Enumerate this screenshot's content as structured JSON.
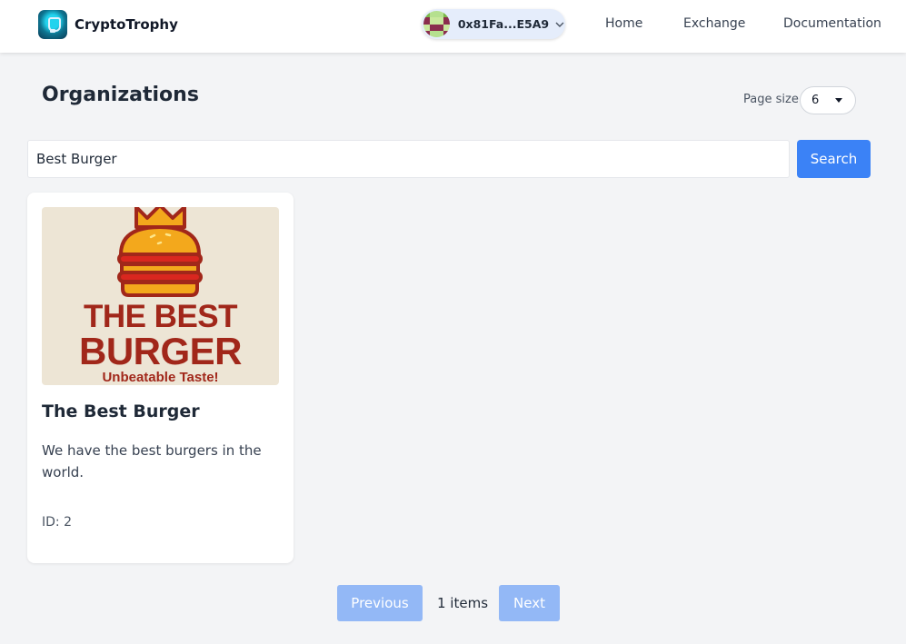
{
  "header": {
    "brand_name": "CryptoTrophy",
    "wallet_address": "0x81Fa...E5A9",
    "nav": {
      "home": "Home",
      "exchange": "Exchange",
      "documentation": "Documentation"
    }
  },
  "icons": {
    "brand": "trophy-logo-icon",
    "wallet_avatar": "identicon-avatar",
    "wallet_menu": "chevron-down-icon",
    "page_size_menu": "caret-down-icon"
  },
  "main": {
    "title": "Organizations",
    "page_size_label": "Page size",
    "page_size_value": "6",
    "search": {
      "value": "Best Burger",
      "button_label": "Search"
    },
    "organizations": [
      {
        "image_text": {
          "line1": "THE BEST",
          "line2": "BURGER",
          "line3": "Unbeatable Taste!"
        },
        "name": "The Best Burger",
        "description": "We have the best burgers in the world.",
        "id_label": "ID: 2"
      }
    ],
    "pagination": {
      "previous_label": "Previous",
      "count_label": "1 items",
      "next_label": "Next"
    }
  },
  "colors": {
    "accent": "#3b82f6",
    "accent_disabled": "#93b8f6",
    "background": "#f3f4f6",
    "brand_red": "#a1271a",
    "bun_orange": "#f3a81c"
  }
}
